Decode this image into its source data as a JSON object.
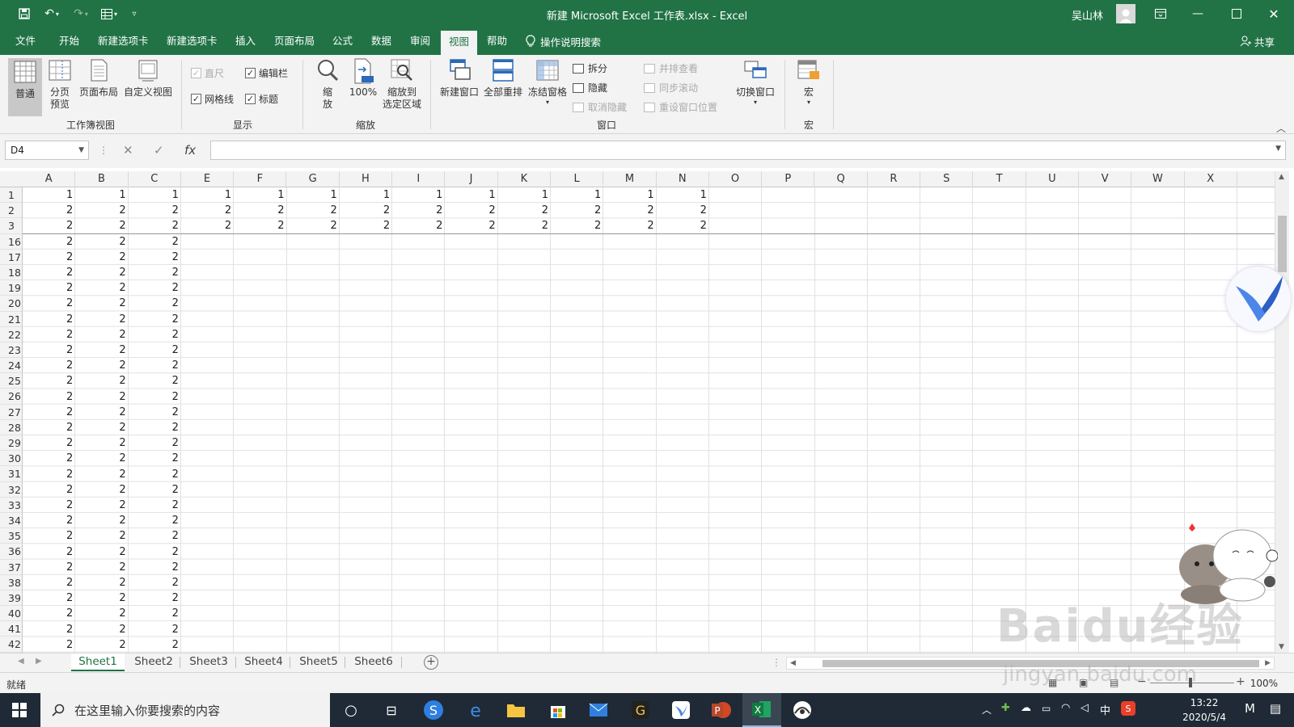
{
  "window": {
    "title": "新建 Microsoft Excel 工作表.xlsx  -  Excel",
    "user": "吴山林"
  },
  "menu": {
    "tabs": [
      "文件",
      "开始",
      "新建选项卡",
      "新建选项卡",
      "插入",
      "页面布局",
      "公式",
      "数据",
      "审阅",
      "视图",
      "帮助"
    ],
    "active_tab": "视图",
    "tell_me": "操作说明搜索",
    "share": "共享"
  },
  "ribbon": {
    "workbook_views": {
      "label": "工作簿视图",
      "normal": "普通",
      "page_break_1": "分页",
      "page_break_2": "预览",
      "page_layout": "页面布局",
      "custom_views": "自定义视图"
    },
    "show": {
      "label": "显示",
      "ruler": "直尺",
      "formula_bar": "编辑栏",
      "gridlines": "网格线",
      "headings": "标题"
    },
    "zoom": {
      "label": "缩放",
      "zoom_1": "缩",
      "zoom_2": "放",
      "hundred": "100%",
      "zoom_sel_1": "缩放到",
      "zoom_sel_2": "选定区域"
    },
    "window": {
      "label": "窗口",
      "new_window": "新建窗口",
      "arrange_all": "全部重排",
      "freeze_panes": "冻结窗格",
      "split": "拆分",
      "hide": "隐藏",
      "unhide": "取消隐藏",
      "side_by_side": "并排查看",
      "sync_scroll": "同步滚动",
      "reset_position": "重设窗口位置",
      "switch_windows": "切换窗口"
    },
    "macros": {
      "label": "宏",
      "button": "宏"
    }
  },
  "formula_bar": {
    "name_box": "D4",
    "fx": "fx",
    "cancel": "✕",
    "enter": "✓",
    "value": ""
  },
  "grid": {
    "columns": [
      "A",
      "B",
      "C",
      "E",
      "F",
      "G",
      "H",
      "I",
      "J",
      "K",
      "L",
      "M",
      "N",
      "O",
      "P",
      "Q",
      "R",
      "S",
      "T",
      "U",
      "V",
      "W",
      "X"
    ],
    "rows": [
      {
        "num": "1",
        "cells": [
          "1",
          "1",
          "1",
          "1",
          "1",
          "1",
          "1",
          "1",
          "1",
          "1",
          "1",
          "1",
          "1"
        ]
      },
      {
        "num": "2",
        "cells": [
          "2",
          "2",
          "2",
          "2",
          "2",
          "2",
          "2",
          "2",
          "2",
          "2",
          "2",
          "2",
          "2"
        ]
      },
      {
        "num": "3",
        "cells": [
          "2",
          "2",
          "2",
          "2",
          "2",
          "2",
          "2",
          "2",
          "2",
          "2",
          "2",
          "2",
          "2"
        ]
      },
      {
        "num": "16",
        "cells": [
          "2",
          "2",
          "2"
        ]
      },
      {
        "num": "17",
        "cells": [
          "2",
          "2",
          "2"
        ]
      },
      {
        "num": "18",
        "cells": [
          "2",
          "2",
          "2"
        ]
      },
      {
        "num": "19",
        "cells": [
          "2",
          "2",
          "2"
        ]
      },
      {
        "num": "20",
        "cells": [
          "2",
          "2",
          "2"
        ]
      },
      {
        "num": "21",
        "cells": [
          "2",
          "2",
          "2"
        ]
      },
      {
        "num": "22",
        "cells": [
          "2",
          "2",
          "2"
        ]
      },
      {
        "num": "23",
        "cells": [
          "2",
          "2",
          "2"
        ]
      },
      {
        "num": "24",
        "cells": [
          "2",
          "2",
          "2"
        ]
      },
      {
        "num": "25",
        "cells": [
          "2",
          "2",
          "2"
        ]
      },
      {
        "num": "26",
        "cells": [
          "2",
          "2",
          "2"
        ]
      },
      {
        "num": "27",
        "cells": [
          "2",
          "2",
          "2"
        ]
      },
      {
        "num": "28",
        "cells": [
          "2",
          "2",
          "2"
        ]
      },
      {
        "num": "29",
        "cells": [
          "2",
          "2",
          "2"
        ]
      },
      {
        "num": "30",
        "cells": [
          "2",
          "2",
          "2"
        ]
      },
      {
        "num": "31",
        "cells": [
          "2",
          "2",
          "2"
        ]
      },
      {
        "num": "32",
        "cells": [
          "2",
          "2",
          "2"
        ]
      },
      {
        "num": "33",
        "cells": [
          "2",
          "2",
          "2"
        ]
      },
      {
        "num": "34",
        "cells": [
          "2",
          "2",
          "2"
        ]
      },
      {
        "num": "35",
        "cells": [
          "2",
          "2",
          "2"
        ]
      },
      {
        "num": "36",
        "cells": [
          "2",
          "2",
          "2"
        ]
      },
      {
        "num": "37",
        "cells": [
          "2",
          "2",
          "2"
        ]
      },
      {
        "num": "38",
        "cells": [
          "2",
          "2",
          "2"
        ]
      },
      {
        "num": "39",
        "cells": [
          "2",
          "2",
          "2"
        ]
      },
      {
        "num": "40",
        "cells": [
          "2",
          "2",
          "2"
        ]
      },
      {
        "num": "41",
        "cells": [
          "2",
          "2",
          "2"
        ]
      },
      {
        "num": "42",
        "cells": [
          "2",
          "2",
          "2"
        ]
      }
    ]
  },
  "sheets": {
    "tabs": [
      "Sheet1",
      "Sheet2",
      "Sheet3",
      "Sheet4",
      "Sheet5",
      "Sheet6"
    ],
    "active": "Sheet1"
  },
  "status": {
    "text": "就绪",
    "zoom": "100%"
  },
  "taskbar": {
    "search_placeholder": "在这里输入你要搜索的内容",
    "time": "13:22",
    "date": "2020/5/4",
    "ime": "中"
  },
  "watermark": {
    "main": "Baidu经验",
    "sub": "jingyan.baidu.com"
  },
  "colors": {
    "excel_green": "#217346",
    "taskbar": "#1f2a36"
  }
}
